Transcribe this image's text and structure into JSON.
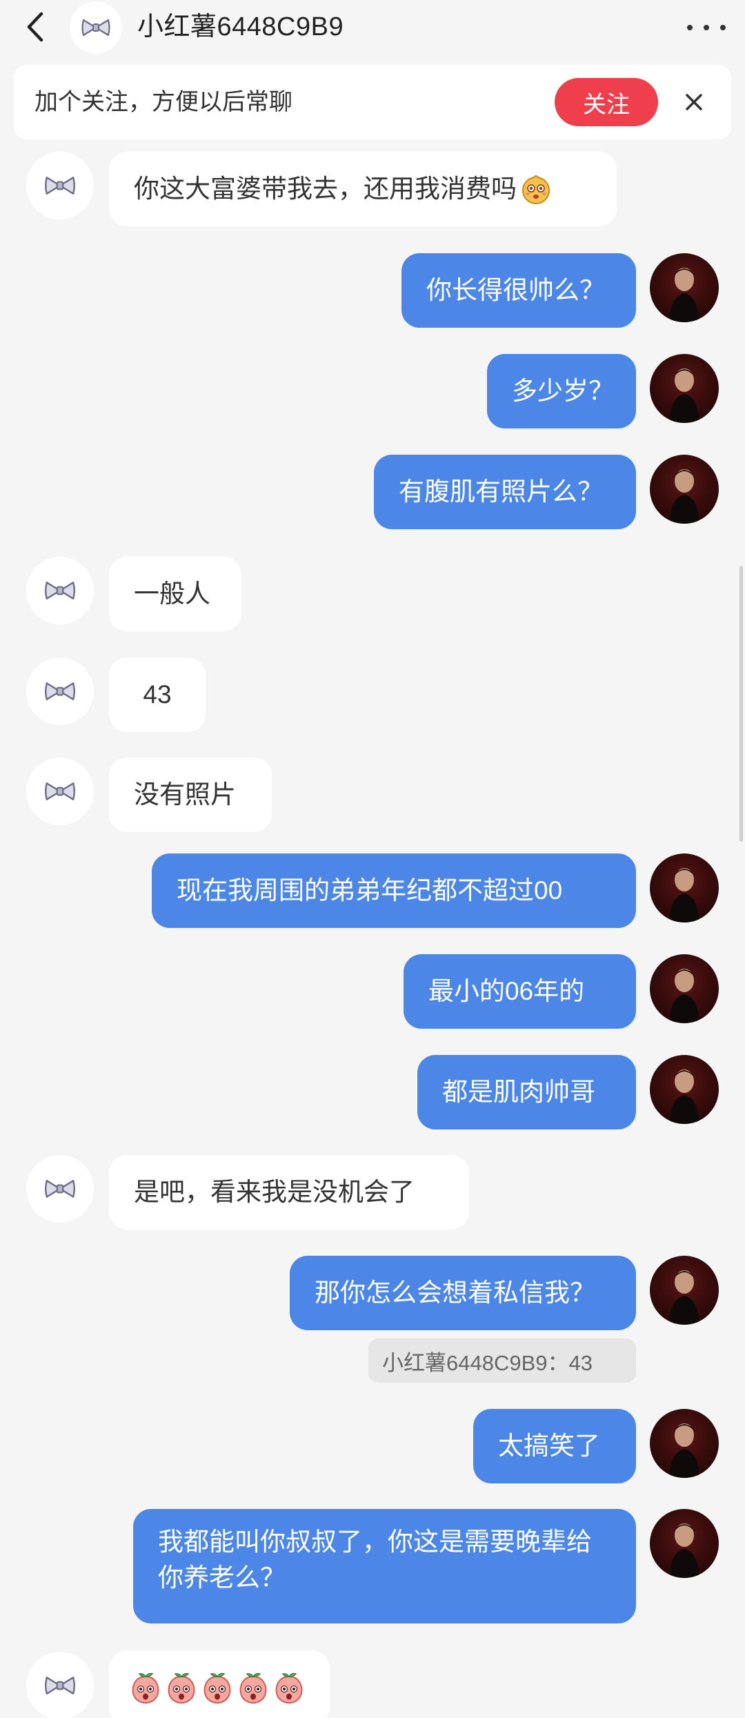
{
  "header": {
    "title": "小红薯6448C9B9",
    "back_icon": "chevron-left-icon",
    "more_icon": "more-dots-icon"
  },
  "follow_banner": {
    "text": "加个关注，方便以后常聊",
    "button_label": "关注",
    "button_color": "#ef3f4d"
  },
  "colors": {
    "my_bubble": "#4c86e6",
    "other_bubble": "#ffffff",
    "background": "#f5f5f5"
  },
  "messages": [
    {
      "sender": "other",
      "text": "你这大富婆带我去，还用我消费吗",
      "emoji": "shy-face-emoji"
    },
    {
      "sender": "me",
      "text": "你长得很帅么？"
    },
    {
      "sender": "me",
      "text": "多少岁？"
    },
    {
      "sender": "me",
      "text": "有腹肌有照片么？"
    },
    {
      "sender": "other",
      "text": "一般人"
    },
    {
      "sender": "other",
      "text": "43"
    },
    {
      "sender": "other",
      "text": "没有照片"
    },
    {
      "sender": "me",
      "text": "现在我周围的弟弟年纪都不超过00"
    },
    {
      "sender": "me",
      "text": "最小的06年的"
    },
    {
      "sender": "me",
      "text": "都是肌肉帅哥"
    },
    {
      "sender": "other",
      "text": "是吧，看来我是没机会了"
    },
    {
      "sender": "me",
      "text": "那你怎么会想着私信我？",
      "quote": "小红薯6448C9B9：43"
    },
    {
      "sender": "me",
      "text": "太搞笑了"
    },
    {
      "sender": "me",
      "text": "我都能叫你叔叔了，你这是需要晚辈给你养老么？"
    },
    {
      "sender": "other",
      "text": "",
      "emoji": "peach-emoji",
      "emoji_count": 5
    }
  ]
}
